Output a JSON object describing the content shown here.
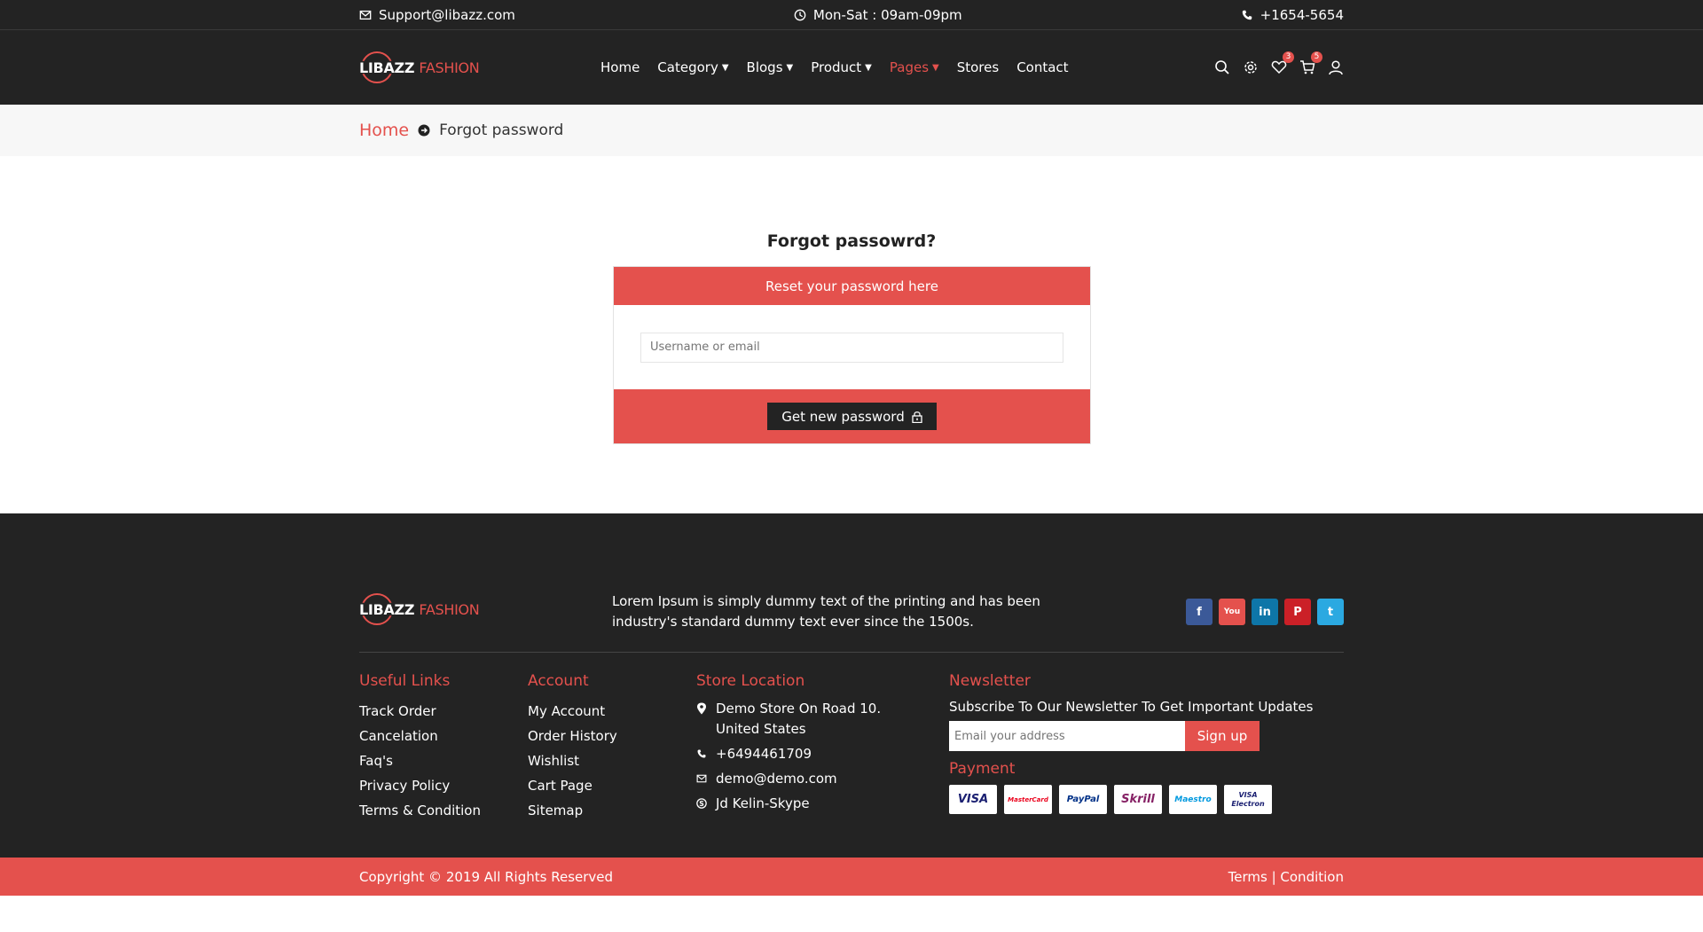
{
  "topbar": {
    "email": "Support@libazz.com",
    "hours": "Mon-Sat : 09am-09pm",
    "phone": "+1654-5654"
  },
  "brand": {
    "part1": "LIBAZZ",
    "part2": "FASHION",
    "accent": "#e4514d"
  },
  "nav": {
    "items": [
      {
        "label": "Home",
        "dropdown": false,
        "active": false
      },
      {
        "label": "Category",
        "dropdown": true,
        "active": false
      },
      {
        "label": "Blogs",
        "dropdown": true,
        "active": false
      },
      {
        "label": "Product",
        "dropdown": true,
        "active": false
      },
      {
        "label": "Pages",
        "dropdown": true,
        "active": true
      },
      {
        "label": "Stores",
        "dropdown": false,
        "active": false
      },
      {
        "label": "Contact",
        "dropdown": false,
        "active": false
      }
    ]
  },
  "header_icons": {
    "wishlist_count": "3",
    "cart_count": "5"
  },
  "breadcrumb": {
    "home": "Home",
    "current": "Forgot password"
  },
  "form": {
    "title": "Forgot passowrd?",
    "head": "Reset your password here",
    "input_placeholder": "Username or email",
    "button": "Get new password"
  },
  "footer": {
    "description": "Lorem Ipsum is simply dummy text of the printing and has been industry's standard dummy text ever since the 1500s.",
    "socials": [
      "f",
      "You",
      "in",
      "P",
      "t"
    ],
    "useful_links": {
      "title": "Useful Links",
      "items": [
        "Track Order",
        "Cancelation",
        "Faq's",
        "Privacy Policy",
        "Terms & Condition"
      ]
    },
    "account": {
      "title": "Account",
      "items": [
        "My Account",
        "Order History",
        "Wishlist",
        "Cart Page",
        "Sitemap"
      ]
    },
    "store": {
      "title": "Store Location",
      "address": "Demo Store On Road 10. United States",
      "phone": "+6494461709",
      "email": "demo@demo.com",
      "skype": "Jd Kelin-Skype"
    },
    "newsletter": {
      "title": "Newsletter",
      "subtitle": "Subscribe To Our Newsletter To Get Important Updates",
      "placeholder": "Email your address",
      "button": "Sign up"
    },
    "payment": {
      "title": "Payment",
      "methods": [
        "VISA",
        "MasterCard",
        "PayPal",
        "Skrill",
        "Maestro",
        "VISA Electron"
      ]
    }
  },
  "copyright": {
    "text": "Copyright © 2019 All Rights Reserved",
    "terms": "Terms",
    "condition": "Condition"
  }
}
